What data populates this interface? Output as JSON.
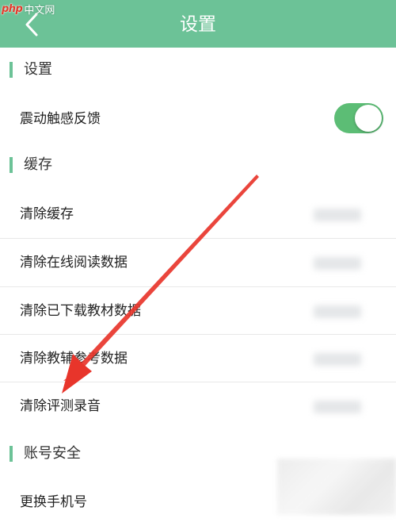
{
  "watermark": {
    "brand": "php",
    "site": "中文网"
  },
  "header": {
    "title": "设置"
  },
  "sections": [
    {
      "title": "设置"
    },
    {
      "title": "缓存"
    },
    {
      "title": "账号安全"
    }
  ],
  "settings": {
    "vibration_label": "震动触感反馈",
    "vibration_on": true
  },
  "cache_rows": [
    {
      "label": "清除缓存"
    },
    {
      "label": "清除在线阅读数据"
    },
    {
      "label": "清除已下载教材数据"
    },
    {
      "label": "清除教辅参考数据"
    },
    {
      "label": "清除评测录音"
    }
  ],
  "account_rows": [
    {
      "label": "更换手机号"
    }
  ],
  "colors": {
    "header_bg": "#6cc297",
    "accent": "#6cc297",
    "toggle_on": "#5cbd75",
    "arrow": "#e8352b"
  },
  "icons": {
    "back": "chevron-left-icon",
    "annotation": "red-arrow-annotation"
  }
}
